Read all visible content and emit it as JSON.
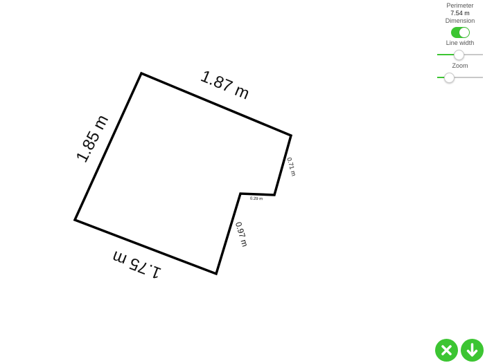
{
  "colors": {
    "accent": "#3cc532",
    "shape_stroke": "#000000",
    "label_text": "#111111"
  },
  "panel": {
    "perimeter_label": "Perimeter",
    "perimeter_value": "7.54 m",
    "dimension_label": "Dimension",
    "dimension_enabled": true,
    "line_width_label": "Line width",
    "line_width_level": 0.47,
    "zoom_label": "Zoom",
    "zoom_level": 0.25
  },
  "shape": {
    "edges": [
      {
        "label": "1.87 m"
      },
      {
        "label": "0.71 m"
      },
      {
        "label": "0.29 m"
      },
      {
        "label": "0.97 m"
      },
      {
        "label": "1.75 m"
      },
      {
        "label": "1.85 m"
      }
    ]
  },
  "actions": {
    "cancel_icon": "close-icon",
    "download_icon": "download-arrow-icon"
  }
}
